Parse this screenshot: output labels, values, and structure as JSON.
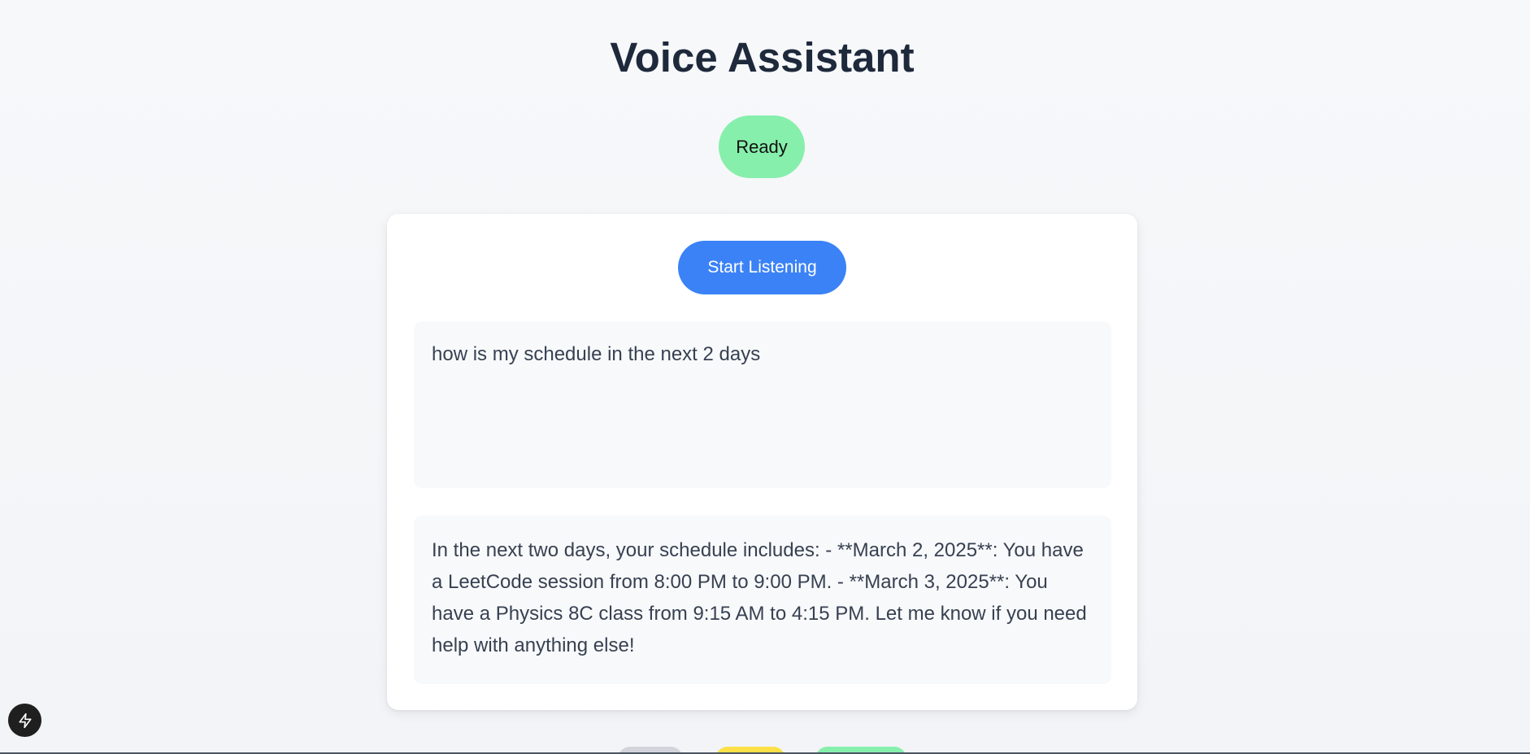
{
  "header": {
    "title": "Voice Assistant"
  },
  "status": {
    "label": "Ready",
    "color": "#86efac"
  },
  "controls": {
    "start_label": "Start Listening",
    "accent_color": "#3b82f6"
  },
  "transcript": {
    "text": "how is my schedule in the next 2 days"
  },
  "response": {
    "text": "In the next two days, your schedule includes: - **March 2, 2025**: You have a LeetCode session from 8:00 PM to 9:00 PM. - **March 3, 2025**: You have a Physics 8C class from 9:15 AM to 4:15 PM. Let me know if you need help with anything else!"
  },
  "icons": {
    "dev_tools": "bolt-icon"
  },
  "bottom_pills": [
    {
      "color": "#d1d5db"
    },
    {
      "color": "#fde047"
    },
    {
      "color": "#86efac"
    }
  ]
}
